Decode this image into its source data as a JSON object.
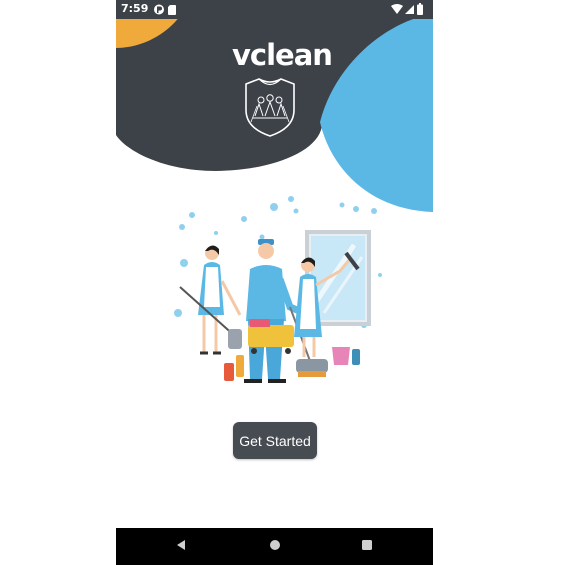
{
  "status_bar": {
    "time": "7:59",
    "left_icons": [
      "app-notification-icon",
      "sd-card-icon"
    ],
    "right_icons": [
      "wifi-icon",
      "signal-icon",
      "battery-icon"
    ]
  },
  "app": {
    "title": "vclean",
    "logo_icon": "cleaning-crest-logo"
  },
  "illustration": "cleaning-staff-illustration",
  "get_started_label": "Get Started",
  "nav_bar": {
    "buttons": [
      "back-icon",
      "home-icon",
      "recents-icon"
    ]
  },
  "colors": {
    "dark": "#3d4148",
    "accent_blue": "#5bb8e5",
    "accent_orange": "#f0a93b",
    "button": "#474b52"
  }
}
